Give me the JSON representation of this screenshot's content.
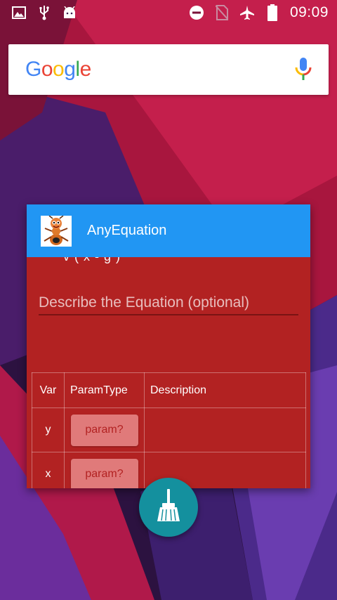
{
  "status_bar": {
    "time": "09:09",
    "icons_left": [
      "image-icon",
      "usb-icon",
      "android-icon"
    ],
    "icons_right": [
      "do-not-disturb-icon",
      "no-sim-icon",
      "airplane-icon",
      "battery-icon"
    ]
  },
  "search": {
    "logo_letters": [
      "G",
      "o",
      "o",
      "g",
      "l",
      "e"
    ],
    "logo_colors": [
      "#4285f4",
      "#ea4335",
      "#fbbc05",
      "#4285f4",
      "#34a853",
      "#ea4335"
    ],
    "mic_icon": "mic-icon"
  },
  "recent_app": {
    "title": "AnyEquation",
    "icon": "ant-mascot-icon",
    "header_color": "#2196f3",
    "body_color": "#b22222",
    "equation_fragment": "v ( x - g )",
    "description_placeholder": "Describe the Equation (optional)",
    "table": {
      "headers": [
        "Var",
        "ParamType",
        "Description"
      ],
      "rows": [
        {
          "var": "y",
          "param_type": "param?",
          "description": ""
        },
        {
          "var": "x",
          "param_type": "param?",
          "description": ""
        }
      ]
    }
  },
  "clear_all": {
    "icon": "broom-icon",
    "color": "#14909e"
  }
}
